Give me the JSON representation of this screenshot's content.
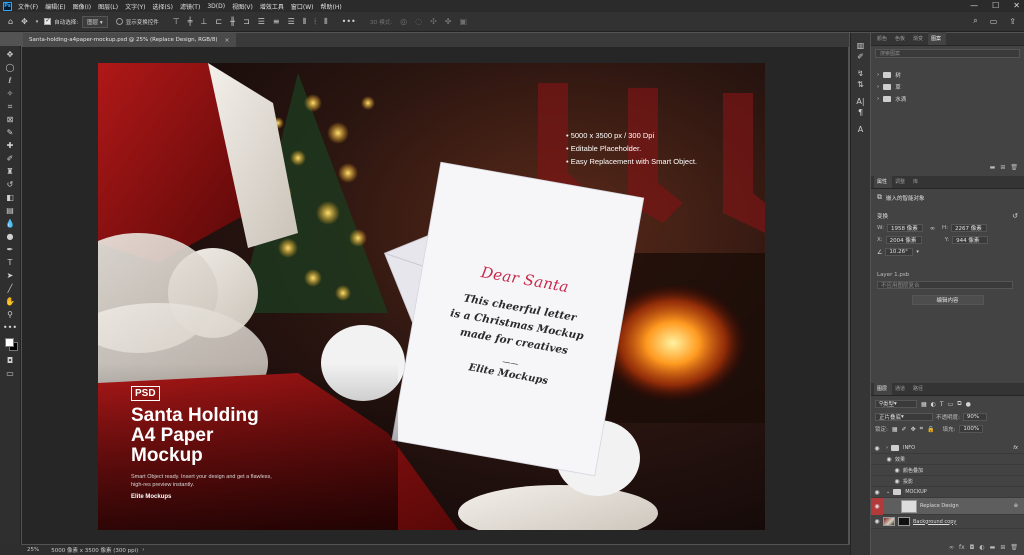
{
  "app": {
    "logo": "Ps",
    "menu": [
      "文件(F)",
      "编辑(E)",
      "图像(I)",
      "图层(L)",
      "文字(Y)",
      "选择(S)",
      "滤镜(T)",
      "3D(D)",
      "视图(V)",
      "增效工具",
      "窗口(W)",
      "帮助(H)"
    ],
    "window_controls": [
      "—",
      "☐",
      "✕"
    ]
  },
  "options_bar": {
    "auto_select_label": "自动选择:",
    "auto_select_value": "图层",
    "show_transform_label": "显示变换控件",
    "mode_label": "3D 模式:"
  },
  "document": {
    "tab_title": "Santa-holding-a4paper-mockup.psd @ 25% (Replace Design, RGB/8)",
    "close_glyph": "×",
    "zoom": "25%",
    "doc_size": "5000 像素 x 3500 像素 (300 ppi)"
  },
  "artwork": {
    "bullets": [
      "5000 x 3500 px / 300 Dpi",
      "Editable Placeholder.",
      "Easy Replacement with Smart Object."
    ],
    "badge": "PSD",
    "title_lines": [
      "Santa Holding",
      "A4 Paper",
      "Mockup"
    ],
    "description": "Smart Object ready. Insert your design and get a flawless, high-res preview instantly.",
    "brand": "Elite Mockups",
    "letter_heading": "Dear Santa",
    "letter_body": [
      "This cheerful letter",
      "is a Christmas Mockup",
      "made for creatives"
    ],
    "letter_rule": "——",
    "letter_sign": "Elite Mockups",
    "colors": {
      "letter_heading": "#c8284a",
      "letter_body": "#2a2a2a"
    }
  },
  "panels": {
    "top_tabs": [
      "颜色",
      "色板",
      "渐变",
      "图案"
    ],
    "top_search_placeholder": "搜索图案",
    "pattern_folders": [
      "树",
      "草",
      "水滴"
    ],
    "props_tabs": [
      "属性",
      "调整",
      "库"
    ],
    "smart_object_label": "嵌入的智能对象",
    "transform_label": "变换",
    "w_label": "W:",
    "w_value": "1958 像素",
    "h_label": "H:",
    "h_value": "2267 像素",
    "x_label": "X:",
    "x_value": "2004 像素",
    "y_label": "Y:",
    "y_value": "944 像素",
    "angle_value": "10.26°",
    "linked_file": "Layer 1.psb",
    "comp_placeholder": "不应用图层复合",
    "edit_contents": "编辑内容",
    "layers_tabs": [
      "图层",
      "通道",
      "路径"
    ],
    "kind_label": "类型",
    "blend_mode": "正片叠底",
    "opacity_label": "不透明度:",
    "opacity_value": "90%",
    "lock_label": "锁定:",
    "fill_label": "填充:",
    "fill_value": "100%",
    "layers": [
      {
        "name": "INFO",
        "fx": "fx"
      },
      {
        "name": "效果"
      },
      {
        "name": "颜色叠加"
      },
      {
        "name": "投影"
      },
      {
        "name": "MOCKUP"
      },
      {
        "name": "Replace Design"
      },
      {
        "name": "Background copy"
      }
    ]
  }
}
